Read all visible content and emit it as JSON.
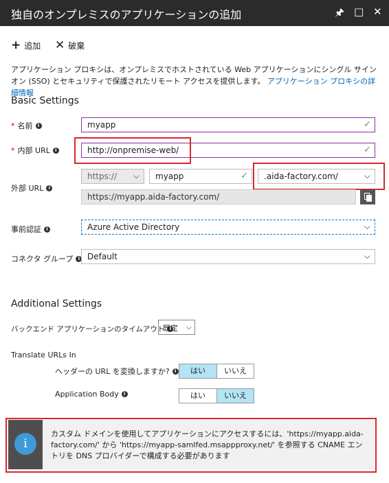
{
  "window": {
    "title": "独自のオンプレミスのアプリケーションの追加",
    "pin_icon": "pin-icon",
    "maximize_icon": "maximize-icon",
    "close_icon": "close-icon"
  },
  "toolbar": {
    "add_label": "追加",
    "discard_label": "破棄"
  },
  "description": {
    "text": "アプリケーション プロキシは、オンプレミスでホストされている Web アプリケーションにシングル サインオン (SSO) とセキュリティで保護されたリモート アクセスを提供します。",
    "link": "アプリケーション プロキシの詳細情報"
  },
  "basic": {
    "heading": "Basic Settings",
    "name": {
      "required_mark": "*",
      "label": "名前",
      "value": "myapp"
    },
    "internal_url": {
      "required_mark": "*",
      "label": "内部 URL",
      "value": "http://onpremise-web/"
    },
    "external_url": {
      "label": "外部 URL",
      "scheme": "https://",
      "subdomain": "myapp",
      "domain": ".aida-factory.com/",
      "full": "https://myapp.aida-factory.com/"
    },
    "preauth": {
      "label": "事前認証",
      "value": "Azure Active Directory"
    },
    "connector_group": {
      "label": "コネクタ グループ",
      "value": "Default"
    }
  },
  "additional": {
    "heading": "Additional Settings",
    "timeout": {
      "label": "バックエンド アプリケーションのタイムアウト",
      "value": "既定"
    },
    "translate_heading": "Translate URLs In",
    "headers": {
      "label": "ヘッダーの URL を変換しますか?",
      "yes": "はい",
      "no": "いいえ",
      "selected": "yes"
    },
    "app_body": {
      "label": "Application Body",
      "yes": "はい",
      "no": "いいえ",
      "selected": "no"
    }
  },
  "notice": {
    "text": "カスタム ドメインを使用してアプリケーションにアクセスするには、'https://myapp.aida-factory.com/' から 'https://myapp-samlfed.msappproxy.net/' を参照する CNAME エントリを DNS プロバイダーで構成する必要があります"
  },
  "colors": {
    "title_bg": "#2b2b2b",
    "accent_border": "#8a2fa0",
    "highlight_red": "#d9262e",
    "toggle_on": "#b3e3f4",
    "link": "#0063b1",
    "info_blue": "#3e9bd7"
  }
}
